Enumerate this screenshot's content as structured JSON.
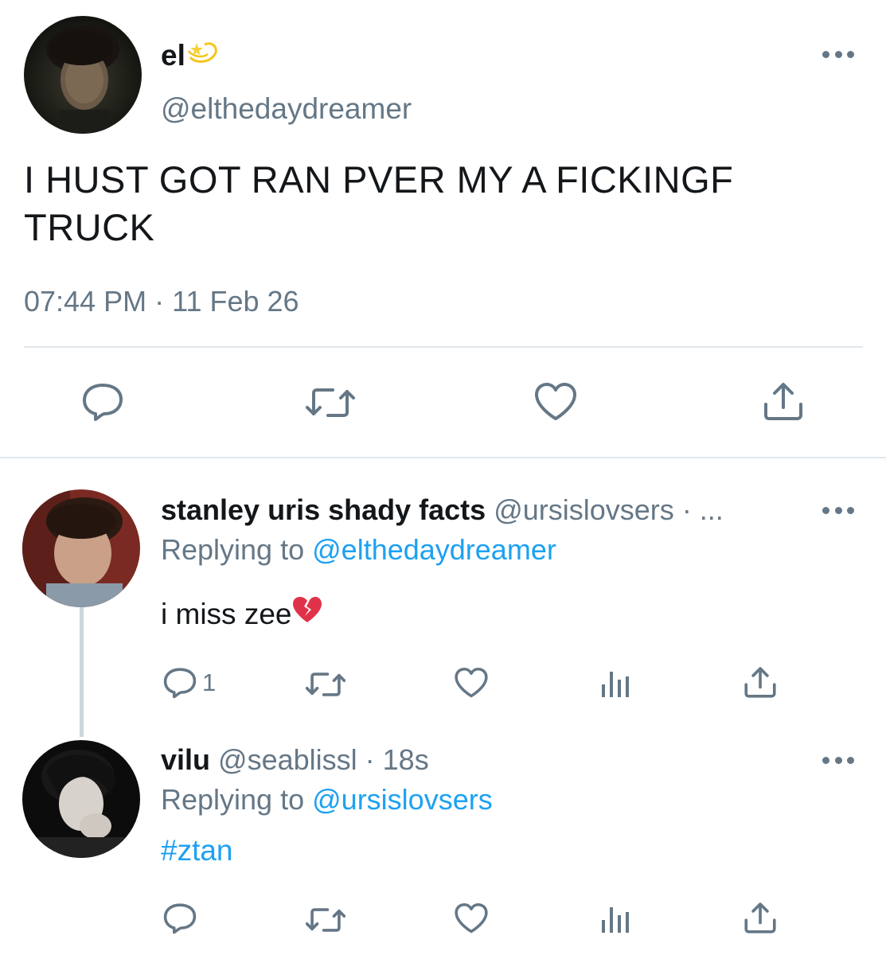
{
  "colors": {
    "text_primary": "#14171a",
    "text_secondary": "#657786",
    "link": "#1da1f2",
    "divider": "#e1e8ed"
  },
  "main_tweet": {
    "display_name": "el",
    "name_emoji": "dizzy-star-emoji",
    "handle": "@elthedaydreamer",
    "text": "I HUST GOT RAN PVER MY A FICKINGF TRUCK",
    "time": "07:44 PM",
    "separator": "·",
    "date": "11 Feb 26",
    "actions": [
      "reply-icon",
      "retweet-icon",
      "like-icon",
      "share-icon"
    ]
  },
  "replies": [
    {
      "display_name": "stanley uris shady facts",
      "handle": "@ursislovsers",
      "meta": "· ...",
      "replying_prefix": "Replying to",
      "replying_to": "@elthedaydreamer",
      "text": "i miss zee",
      "text_emoji": "broken-heart-emoji",
      "reply_count": "1",
      "actions": [
        "reply-icon",
        "retweet-icon",
        "like-icon",
        "analytics-icon",
        "share-icon"
      ]
    },
    {
      "display_name": "vilu",
      "handle": "@seablissl",
      "meta": "· 18s",
      "replying_prefix": "Replying to",
      "replying_to": "@ursislovsers",
      "text": "#ztan",
      "actions": [
        "reply-icon",
        "retweet-icon",
        "like-icon",
        "analytics-icon",
        "share-icon"
      ]
    }
  ]
}
